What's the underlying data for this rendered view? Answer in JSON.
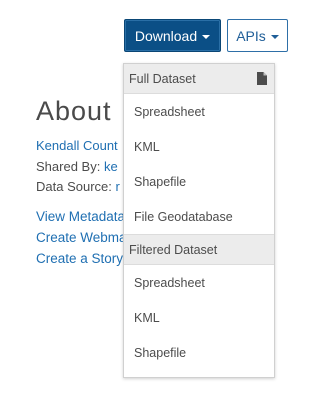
{
  "toolbar": {
    "download_label": "Download",
    "apis_label": "APIs"
  },
  "about": {
    "title": "About",
    "source_link": "Kendall Count",
    "shared_by_label": "Shared By: ",
    "shared_by_value": "ke",
    "data_source_label": "Data Source: ",
    "data_source_value": "r",
    "links": [
      "View Metadata",
      "Create Webma",
      "Create a Story"
    ]
  },
  "dropdown": {
    "sections": [
      {
        "title": "Full Dataset",
        "icon": "document-icon",
        "items": [
          "Spreadsheet",
          "KML",
          "Shapefile",
          "File Geodatabase"
        ]
      },
      {
        "title": "Filtered Dataset",
        "items": [
          "Spreadsheet",
          "KML",
          "Shapefile"
        ]
      }
    ]
  },
  "colors": {
    "primary_button": "#0b4f86",
    "link": "#1f6fb2",
    "section_header_bg": "#ececec"
  }
}
